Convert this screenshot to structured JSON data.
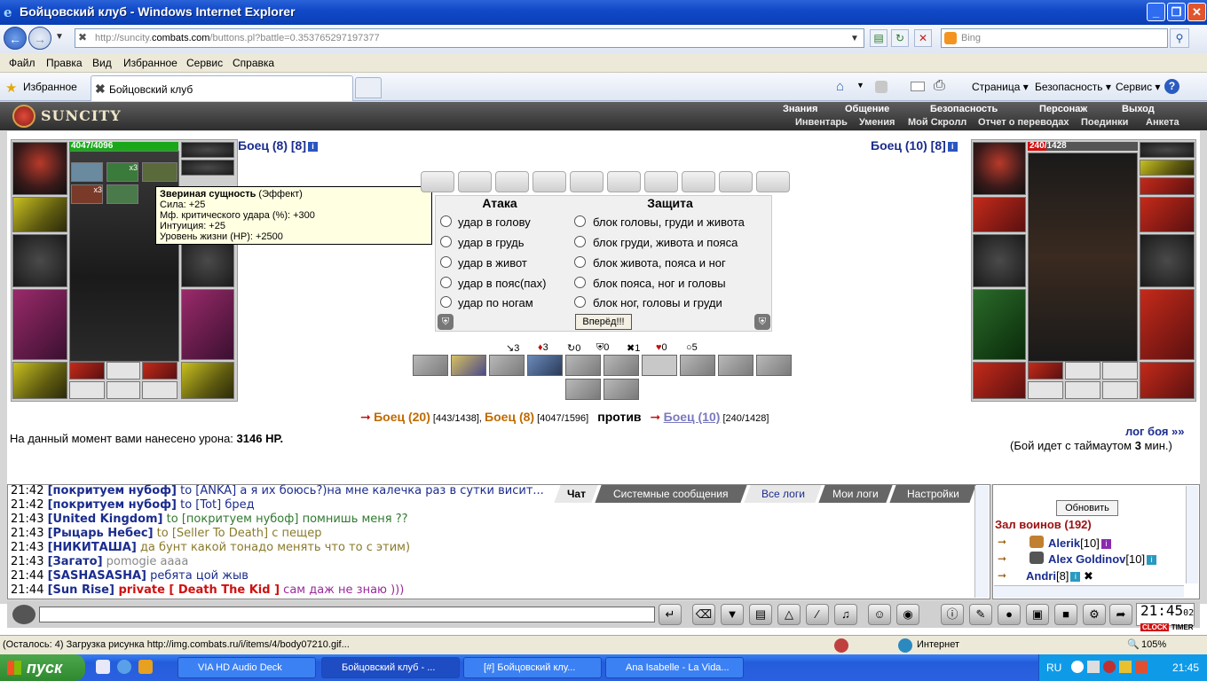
{
  "window": {
    "title": "Бойцовский клуб - Windows Internet Explorer",
    "controls": [
      "_",
      "❐",
      "✕"
    ]
  },
  "address": {
    "url_prefix": "http://suncity.",
    "url_domain": "combats.com",
    "url_path": "/buttons.pl?battle=0.353765297197377",
    "search_placeholder": "Bing"
  },
  "menu": [
    "Файл",
    "Правка",
    "Вид",
    "Избранное",
    "Сервис",
    "Справка"
  ],
  "favorites": {
    "label": "Избранное",
    "tab_title": "Бойцовский клуб"
  },
  "commandbar": [
    "Страница ▾",
    "Безопасность ▾",
    "Сервис ▾"
  ],
  "game": {
    "logo": "SUNCITY",
    "topnav": [
      "Знания",
      "Общение",
      "Безопасность",
      "Персонаж",
      "Выход"
    ],
    "subnav": [
      "Инвентарь",
      "Умения",
      "Мой Скролл",
      "Отчет о переводах",
      "Поединки",
      "Анкета"
    ],
    "left_fighter": {
      "name": "Боец (8) [8]",
      "hp": "4047/4096",
      "hp_fraction": 0.988
    },
    "right_fighter": {
      "name": "Боец (10) [8]",
      "hp_current": "240",
      "hp_max": "/1428",
      "hp_fraction": 0.168
    },
    "tooltip": {
      "title": "Звериная сущность",
      "kind": " (Эффект)",
      "lines": [
        "Сила: +25",
        "Мф. критического удара (%): +300",
        "Интуиция: +25",
        "Уровень жизни (HP): +2500"
      ]
    },
    "badge_x3": "x3",
    "attack": {
      "title": "Атака",
      "options": [
        "удар в голову",
        "удар в грудь",
        "удар в живот",
        "удар в пояс(пах)",
        "удар по ногам"
      ]
    },
    "defense": {
      "title": "Защита",
      "options": [
        "блок головы, груди и живота",
        "блок груди, живота и пояса",
        "блок живота, пояса и ног",
        "блок пояса, ног и головы",
        "блок ног, головы и груди"
      ]
    },
    "forward_button": "Вперёд!!!",
    "stats": [
      "3",
      "3",
      "0",
      "0",
      "1",
      "0",
      "5"
    ],
    "battle": {
      "f1": "Боец (20)",
      "f1_hp": " [443/1438], ",
      "f2": "Боец (8)",
      "f2_hp": " [4047/1596]",
      "vs": "против",
      "f3": "Боец (10)",
      "f3_hp": " [240/1428]"
    },
    "damage_label": "На данный момент вами нанесено урона: ",
    "damage_value": "3146 HP.",
    "log_link": "лог боя »»",
    "timeout_prefix": "(Бой идет с таймаутом ",
    "timeout_value": "3",
    "timeout_suffix": " мин.)"
  },
  "chat": {
    "tabs": [
      "Чат",
      "Системные сообщения",
      "Все логи",
      "Мои логи",
      "Настройки"
    ],
    "lines": [
      {
        "time": "21:42 ",
        "nick": "[покритуем нубоф]",
        "to": " to [ANKA]",
        "text": " а я их боюсь?)на мне калечка раз в сутки висит...",
        "to_color": "#1a2c8e",
        "text_color": "#1a2c8e"
      },
      {
        "time": "21:42 ",
        "nick": "[покритуем нубоф]",
        "to": " to [Tot]",
        "text": " бред",
        "to_color": "#1a2c8e",
        "text_color": "#1a2c8e"
      },
      {
        "time": "21:43 ",
        "nick": "[United Kingdom]",
        "to": " to [покритуем нубоф]",
        "text": " помнишь меня ??",
        "to_color": "#2f7a2f",
        "text_color": "#2f7a2f"
      },
      {
        "time": "21:43 ",
        "nick": "[Рыцарь Небес]",
        "to": " to [Seller To Death]",
        "text": " с пещер",
        "to_color": "#8a7a2a",
        "text_color": "#8a7a2a"
      },
      {
        "time": "21:43 ",
        "nick": "[НИКИТАША]",
        "to": "",
        "text": " да бунт какой тонадо менять что то с этим)",
        "to_color": "#8a7a2a",
        "text_color": "#8a7a2a"
      },
      {
        "time": "21:43 ",
        "nick": "[Загато]",
        "to": "",
        "text": " pomogie aaaa",
        "to_color": "#888",
        "text_color": "#888"
      },
      {
        "time": "21:44 ",
        "nick": "[SASHASASHA]",
        "to": "",
        "text": " ребята цой жыв",
        "to_color": "#1a2c8e",
        "text_color": "#1a2c8e"
      },
      {
        "time": "21:44 ",
        "nick": "[Sun Rise]",
        "to": " private [ Death The Kid ]",
        "text": " сам даж не знаю )))",
        "to_color": "#d01010",
        "text_color": "#9a2a9a"
      }
    ]
  },
  "hall": {
    "refresh": "Обновить",
    "title": "Зал воинов (192)",
    "players": [
      {
        "name": "Alerik",
        "level": "[10]"
      },
      {
        "name": "Alex Goldinov",
        "level": "[10]"
      },
      {
        "name": "Andri",
        "level": "[8]"
      }
    ]
  },
  "clock": {
    "time": "21:45",
    "sec": "02",
    "l1": "CLOCK",
    "l2": "TIMER"
  },
  "status": {
    "text": "(Осталось: 4) Загрузка рисунка http://img.combats.ru/i/items/4/body07210.gif...",
    "zone": "Интернет",
    "zoom": "105%"
  },
  "taskbar": {
    "start": "пуск",
    "tasks": [
      "VIA HD Audio Deck",
      "Бойцовский клуб - ...",
      "[#] Бойцовский клу...",
      "Ana Isabelle - La Vida..."
    ],
    "lang": "RU",
    "time": "21:45"
  },
  "colors": {
    "accent": "#1a2c8e",
    "battle_orange": "#c06a00",
    "hp_green": "#1aa81a",
    "hp_red": "#d01010"
  }
}
